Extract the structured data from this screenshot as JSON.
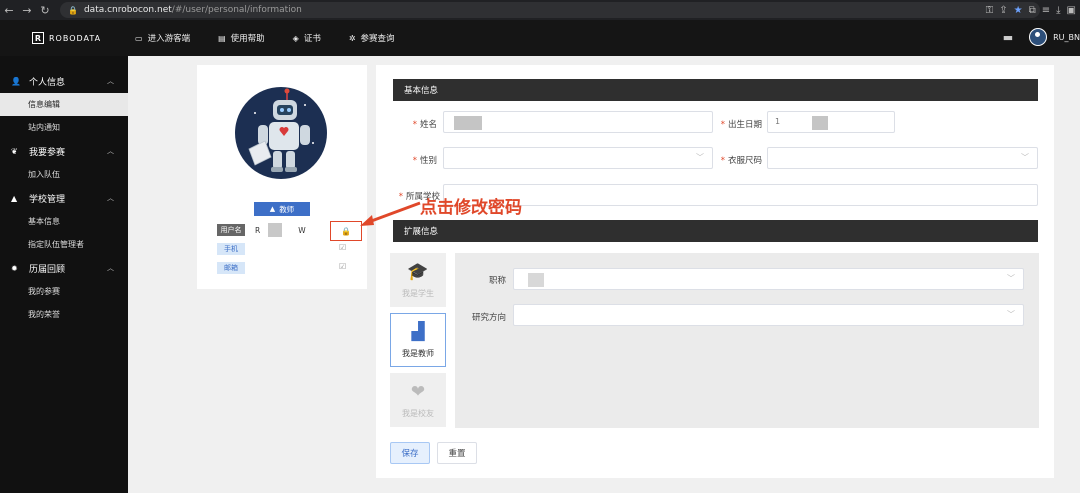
{
  "browser": {
    "url_host": "data.cnrobocon.net",
    "url_path": "/#/user/personal/information"
  },
  "app": {
    "logo_mark": "R",
    "logo_text": "ROBODATA",
    "nav": [
      {
        "label": "进入游客端",
        "icon": "tv-icon"
      },
      {
        "label": "使用帮助",
        "icon": "book-icon"
      },
      {
        "label": "证书",
        "icon": "certificate-icon"
      },
      {
        "label": "参赛查询",
        "icon": "gear-icon"
      }
    ],
    "username": "RU_BN"
  },
  "sidebar": {
    "groups": [
      {
        "label": "个人信息",
        "icon": "user-icon",
        "items": [
          "信息编辑",
          "站内通知"
        ]
      },
      {
        "label": "我要参赛",
        "icon": "leaf-icon",
        "items": [
          "加入队伍"
        ]
      },
      {
        "label": "学校管理",
        "icon": "school-icon",
        "items": [
          "基本信息",
          "指定队伍管理者"
        ]
      },
      {
        "label": "历届回顾",
        "icon": "gear-icon",
        "items": [
          "我的参赛",
          "我的荣誉"
        ]
      }
    ],
    "active_item": "信息编辑"
  },
  "profile": {
    "role_badge": "教师",
    "rows": [
      {
        "label": "用户名",
        "value_start": "R",
        "value_end": "W"
      },
      {
        "label": "手机"
      },
      {
        "label": "邮箱"
      }
    ]
  },
  "annotation": {
    "text": "点击修改密码",
    "color": "#e0482a"
  },
  "basic_info": {
    "section_title": "基本信息",
    "fields": {
      "name": "姓名",
      "birth": "出生日期",
      "gender": "性别",
      "size": "衣服尺码",
      "school": "所属学校"
    },
    "birth_value": "1"
  },
  "ext_info": {
    "section_title": "扩展信息",
    "roles": [
      {
        "label": "我是学生",
        "icon": "graduation-cap-icon",
        "active": false
      },
      {
        "label": "我是教师",
        "icon": "teacher-icon",
        "active": true
      },
      {
        "label": "我是校友",
        "icon": "heart-chat-icon",
        "active": false
      }
    ],
    "fields": {
      "title": "职称",
      "research": "研究方向"
    }
  },
  "actions": {
    "save": "保存",
    "reset": "重置"
  },
  "colors": {
    "accent": "#3d6fc7",
    "annotation": "#e0482a",
    "header": "#151515",
    "sidebar": "#111111"
  }
}
